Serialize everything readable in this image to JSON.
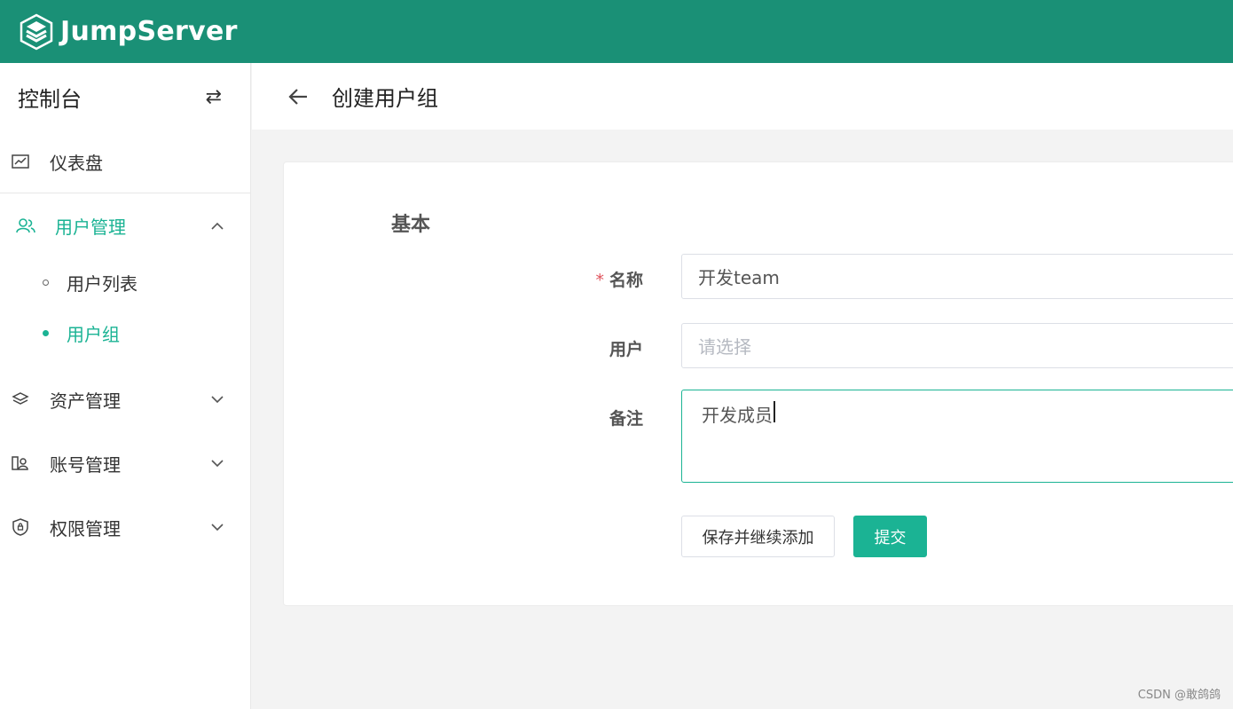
{
  "brand": {
    "name": "JumpServer",
    "logo_icon": "stacked-layers-logo"
  },
  "sidebar": {
    "title": "控制台",
    "toggle_icon": "swap-arrows-icon",
    "items": [
      {
        "label": "仪表盘",
        "icon": "chart-icon"
      },
      {
        "label": "用户管理",
        "icon": "users-icon",
        "expanded": true,
        "active": true,
        "children": [
          {
            "label": "用户列表"
          },
          {
            "label": "用户组",
            "active": true
          }
        ]
      },
      {
        "label": "资产管理",
        "icon": "layers-icon"
      },
      {
        "label": "账号管理",
        "icon": "account-icon"
      },
      {
        "label": "权限管理",
        "icon": "shield-icon"
      }
    ]
  },
  "header": {
    "title": "创建用户组",
    "back_icon": "arrow-left-icon"
  },
  "form": {
    "section": "基本",
    "name": {
      "label": "名称",
      "required_mark": "*",
      "value": "开发team"
    },
    "users": {
      "label": "用户",
      "placeholder": "请选择"
    },
    "comment": {
      "label": "备注",
      "value": "开发成员"
    },
    "buttons": {
      "save_continue": "保存并继续添加",
      "submit": "提交"
    }
  },
  "watermark": "CSDN @敢鸽鸽",
  "colors": {
    "topbar": "#1a9076",
    "accent": "#1bb394",
    "required": "#e0535c"
  }
}
